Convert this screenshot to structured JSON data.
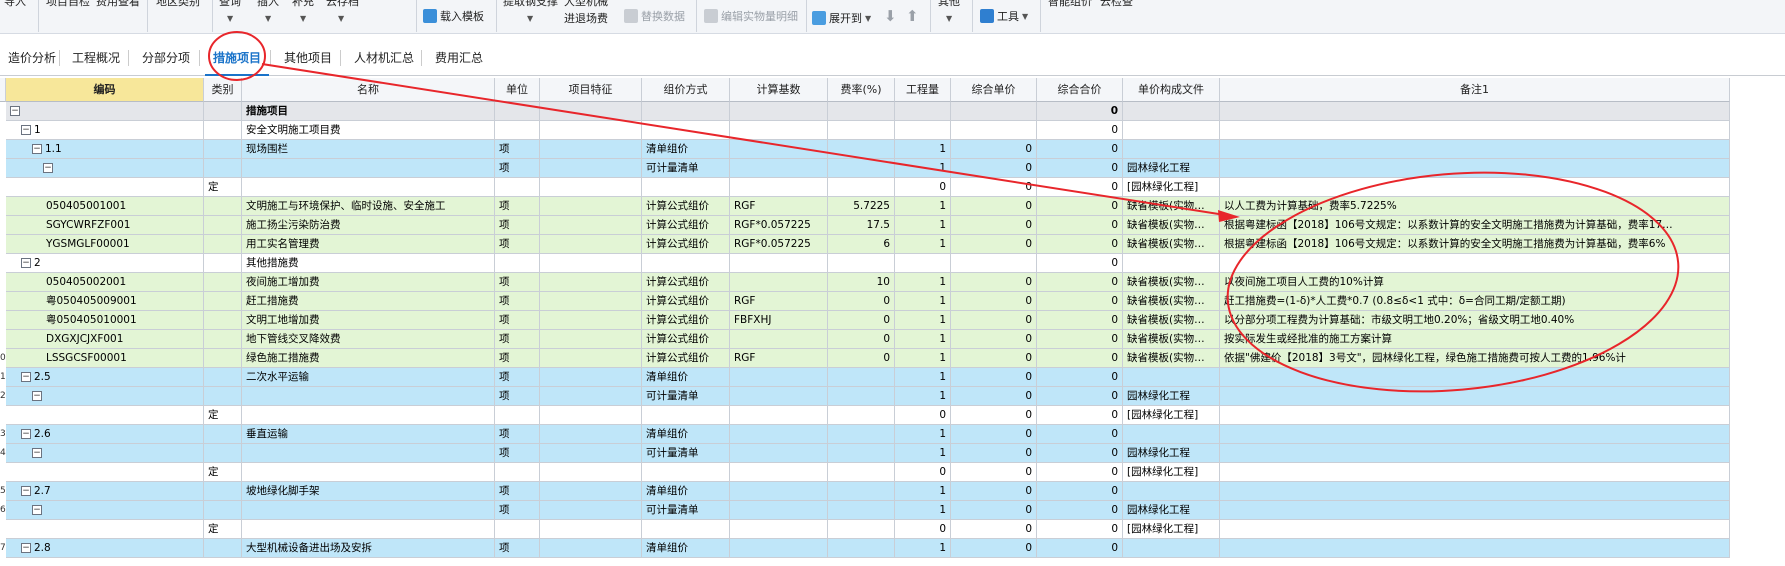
{
  "toolbar": {
    "import_line1": "导入",
    "project_check": "项目自检",
    "fee_view": "费用查看",
    "region_type": "地区类别",
    "query": "查询",
    "insert": "插入",
    "supplement": "补充",
    "save_archive": "云存档",
    "load_template": "载入模板",
    "extract_steel": "提取钢支撑",
    "large_mech_l1": "大型机械",
    "large_mech_l2": "进退场费",
    "replace_data": "替换数据",
    "edit_qty_detail": "编辑实物量明细",
    "expand_to": "展开到",
    "other": "其他",
    "tools": "工具",
    "smart_price": "智能组价",
    "cloud_check": "云检查"
  },
  "tabs": [
    {
      "label": "造价分析"
    },
    {
      "label": "工程概况"
    },
    {
      "label": "分部分项"
    },
    {
      "label": "措施项目"
    },
    {
      "label": "其他项目"
    },
    {
      "label": "人材机汇总"
    },
    {
      "label": "费用汇总"
    }
  ],
  "columns": [
    "编码",
    "类别",
    "名称",
    "单位",
    "项目特征",
    "组价方式",
    "计算基数",
    "费率(%)",
    "工程量",
    "综合单价",
    "综合合价",
    "单价构成文件",
    "备注1"
  ],
  "rows": [
    {
      "no": "",
      "code": "",
      "cat": "",
      "name": "措施项目",
      "unit": "",
      "feat": "",
      "method": "",
      "base": "",
      "rate": "",
      "qty": "",
      "up": "",
      "total": "0",
      "file": "",
      "note": "",
      "style": "gray"
    },
    {
      "no": "",
      "code": "1",
      "cat": "",
      "name": "安全文明施工项目费",
      "unit": "",
      "feat": "",
      "method": "",
      "base": "",
      "rate": "",
      "qty": "",
      "up": "",
      "total": "0",
      "file": "",
      "note": "",
      "style": "white"
    },
    {
      "no": "",
      "code": "1.1",
      "cat": "",
      "name": "现场围栏",
      "unit": "项",
      "feat": "",
      "method": "清单组价",
      "base": "",
      "rate": "",
      "qty": "1",
      "up": "0",
      "total": "0",
      "file": "",
      "note": "",
      "style": "blue"
    },
    {
      "no": "",
      "code": "",
      "cat": "",
      "name": "",
      "unit": "项",
      "feat": "",
      "method": "可计量清单",
      "base": "",
      "rate": "",
      "qty": "1",
      "up": "0",
      "total": "0",
      "file": "园林绿化工程",
      "note": "",
      "style": "blue"
    },
    {
      "no": "",
      "code": "",
      "cat": "定",
      "name": "",
      "unit": "",
      "feat": "",
      "method": "",
      "base": "",
      "rate": "",
      "qty": "0",
      "up": "0",
      "total": "0",
      "file": "[园林绿化工程]",
      "note": "",
      "style": "white"
    },
    {
      "no": "",
      "code": "050405001001",
      "cat": "",
      "name": "文明施工与环境保护、临时设施、安全施工",
      "unit": "项",
      "feat": "",
      "method": "计算公式组价",
      "base": "RGF",
      "rate": "5.7225",
      "qty": "1",
      "up": "0",
      "total": "0",
      "file": "缺省模板(实物…",
      "note": "以人工费为计算基础，费率5.7225%",
      "style": "green"
    },
    {
      "no": "",
      "code": "SGYCWRFZF001",
      "cat": "",
      "name": "施工扬尘污染防治费",
      "unit": "项",
      "feat": "",
      "method": "计算公式组价",
      "base": "RGF*0.057225",
      "rate": "17.5",
      "qty": "1",
      "up": "0",
      "total": "0",
      "file": "缺省模板(实物…",
      "note": "根据粤建标函【2018】106号文规定：以系数计算的安全文明施工措施费为计算基础，费率17…",
      "style": "green"
    },
    {
      "no": "",
      "code": "YGSMGLF00001",
      "cat": "",
      "name": "用工实名管理费",
      "unit": "项",
      "feat": "",
      "method": "计算公式组价",
      "base": "RGF*0.057225",
      "rate": "6",
      "qty": "1",
      "up": "0",
      "total": "0",
      "file": "缺省模板(实物…",
      "note": "根据粤建标函【2018】106号文规定：以系数计算的安全文明施工措施费为计算基础，费率6%",
      "style": "green"
    },
    {
      "no": "",
      "code": "2",
      "cat": "",
      "name": "其他措施费",
      "unit": "",
      "feat": "",
      "method": "",
      "base": "",
      "rate": "",
      "qty": "",
      "up": "",
      "total": "0",
      "file": "",
      "note": "",
      "style": "white"
    },
    {
      "no": "",
      "code": "050405002001",
      "cat": "",
      "name": "夜间施工增加费",
      "unit": "项",
      "feat": "",
      "method": "计算公式组价",
      "base": "",
      "rate": "10",
      "qty": "1",
      "up": "0",
      "total": "0",
      "file": "缺省模板(实物…",
      "note": "以夜间施工项目人工费的10%计算",
      "style": "green"
    },
    {
      "no": "",
      "code": "粤050405009001",
      "cat": "",
      "name": "赶工措施费",
      "unit": "项",
      "feat": "",
      "method": "计算公式组价",
      "base": "RGF",
      "rate": "0",
      "qty": "1",
      "up": "0",
      "total": "0",
      "file": "缺省模板(实物…",
      "note": "赶工措施费=(1-δ)*人工费*0.7 (0.8≤δ<1 式中：δ=合同工期/定额工期)",
      "style": "green"
    },
    {
      "no": "",
      "code": "粤050405010001",
      "cat": "",
      "name": "文明工地增加费",
      "unit": "项",
      "feat": "",
      "method": "计算公式组价",
      "base": "FBFXHJ",
      "rate": "0",
      "qty": "1",
      "up": "0",
      "total": "0",
      "file": "缺省模板(实物…",
      "note": "以分部分项工程费为计算基础：市级文明工地0.20%；省级文明工地0.40%",
      "style": "green"
    },
    {
      "no": "",
      "code": "DXGXJCJXF001",
      "cat": "",
      "name": "地下管线交叉降效费",
      "unit": "项",
      "feat": "",
      "method": "计算公式组价",
      "base": "",
      "rate": "0",
      "qty": "1",
      "up": "0",
      "total": "0",
      "file": "缺省模板(实物…",
      "note": "按实际发生或经批准的施工方案计算",
      "style": "green"
    },
    {
      "no": "0",
      "code": "LSSGCSF00001",
      "cat": "",
      "name": "绿色施工措施费",
      "unit": "项",
      "feat": "",
      "method": "计算公式组价",
      "base": "RGF",
      "rate": "0",
      "qty": "1",
      "up": "0",
      "total": "0",
      "file": "缺省模板(实物…",
      "note": "依据\"佛建价【2018】3号文\"，园林绿化工程，绿色施工措施费可按人工费的1.96%计",
      "style": "green"
    },
    {
      "no": "1",
      "code": "2.5",
      "cat": "",
      "name": "二次水平运输",
      "unit": "项",
      "feat": "",
      "method": "清单组价",
      "base": "",
      "rate": "",
      "qty": "1",
      "up": "0",
      "total": "0",
      "file": "",
      "note": "",
      "style": "blue"
    },
    {
      "no": "2",
      "code": "",
      "cat": "",
      "name": "",
      "unit": "项",
      "feat": "",
      "method": "可计量清单",
      "base": "",
      "rate": "",
      "qty": "1",
      "up": "0",
      "total": "0",
      "file": "园林绿化工程",
      "note": "",
      "style": "blue"
    },
    {
      "no": "",
      "code": "",
      "cat": "定",
      "name": "",
      "unit": "",
      "feat": "",
      "method": "",
      "base": "",
      "rate": "",
      "qty": "0",
      "up": "0",
      "total": "0",
      "file": "[园林绿化工程]",
      "note": "",
      "style": "white"
    },
    {
      "no": "3",
      "code": "2.6",
      "cat": "",
      "name": "垂直运输",
      "unit": "项",
      "feat": "",
      "method": "清单组价",
      "base": "",
      "rate": "",
      "qty": "1",
      "up": "0",
      "total": "0",
      "file": "",
      "note": "",
      "style": "blue"
    },
    {
      "no": "4",
      "code": "",
      "cat": "",
      "name": "",
      "unit": "项",
      "feat": "",
      "method": "可计量清单",
      "base": "",
      "rate": "",
      "qty": "1",
      "up": "0",
      "total": "0",
      "file": "园林绿化工程",
      "note": "",
      "style": "blue"
    },
    {
      "no": "",
      "code": "",
      "cat": "定",
      "name": "",
      "unit": "",
      "feat": "",
      "method": "",
      "base": "",
      "rate": "",
      "qty": "0",
      "up": "0",
      "total": "0",
      "file": "[园林绿化工程]",
      "note": "",
      "style": "white"
    },
    {
      "no": "5",
      "code": "2.7",
      "cat": "",
      "name": "坡地绿化脚手架",
      "unit": "项",
      "feat": "",
      "method": "清单组价",
      "base": "",
      "rate": "",
      "qty": "1",
      "up": "0",
      "total": "0",
      "file": "",
      "note": "",
      "style": "blue"
    },
    {
      "no": "6",
      "code": "",
      "cat": "",
      "name": "",
      "unit": "项",
      "feat": "",
      "method": "可计量清单",
      "base": "",
      "rate": "",
      "qty": "1",
      "up": "0",
      "total": "0",
      "file": "园林绿化工程",
      "note": "",
      "style": "blue"
    },
    {
      "no": "",
      "code": "",
      "cat": "定",
      "name": "",
      "unit": "",
      "feat": "",
      "method": "",
      "base": "",
      "rate": "",
      "qty": "0",
      "up": "0",
      "total": "0",
      "file": "[园林绿化工程]",
      "note": "",
      "style": "white"
    },
    {
      "no": "7",
      "code": "2.8",
      "cat": "",
      "name": "大型机械设备进出场及安拆",
      "unit": "项",
      "feat": "",
      "method": "清单组价",
      "base": "",
      "rate": "",
      "qty": "1",
      "up": "0",
      "total": "0",
      "file": "",
      "note": "",
      "style": "blue"
    }
  ],
  "colors": {
    "annotation": "#e8262b",
    "row_blue": "#bfe6f9",
    "row_green": "#e3f5d5",
    "row_gray": "#e4e6ea",
    "header_code": "#f7e79a",
    "active_tab": "#1a73c9"
  }
}
